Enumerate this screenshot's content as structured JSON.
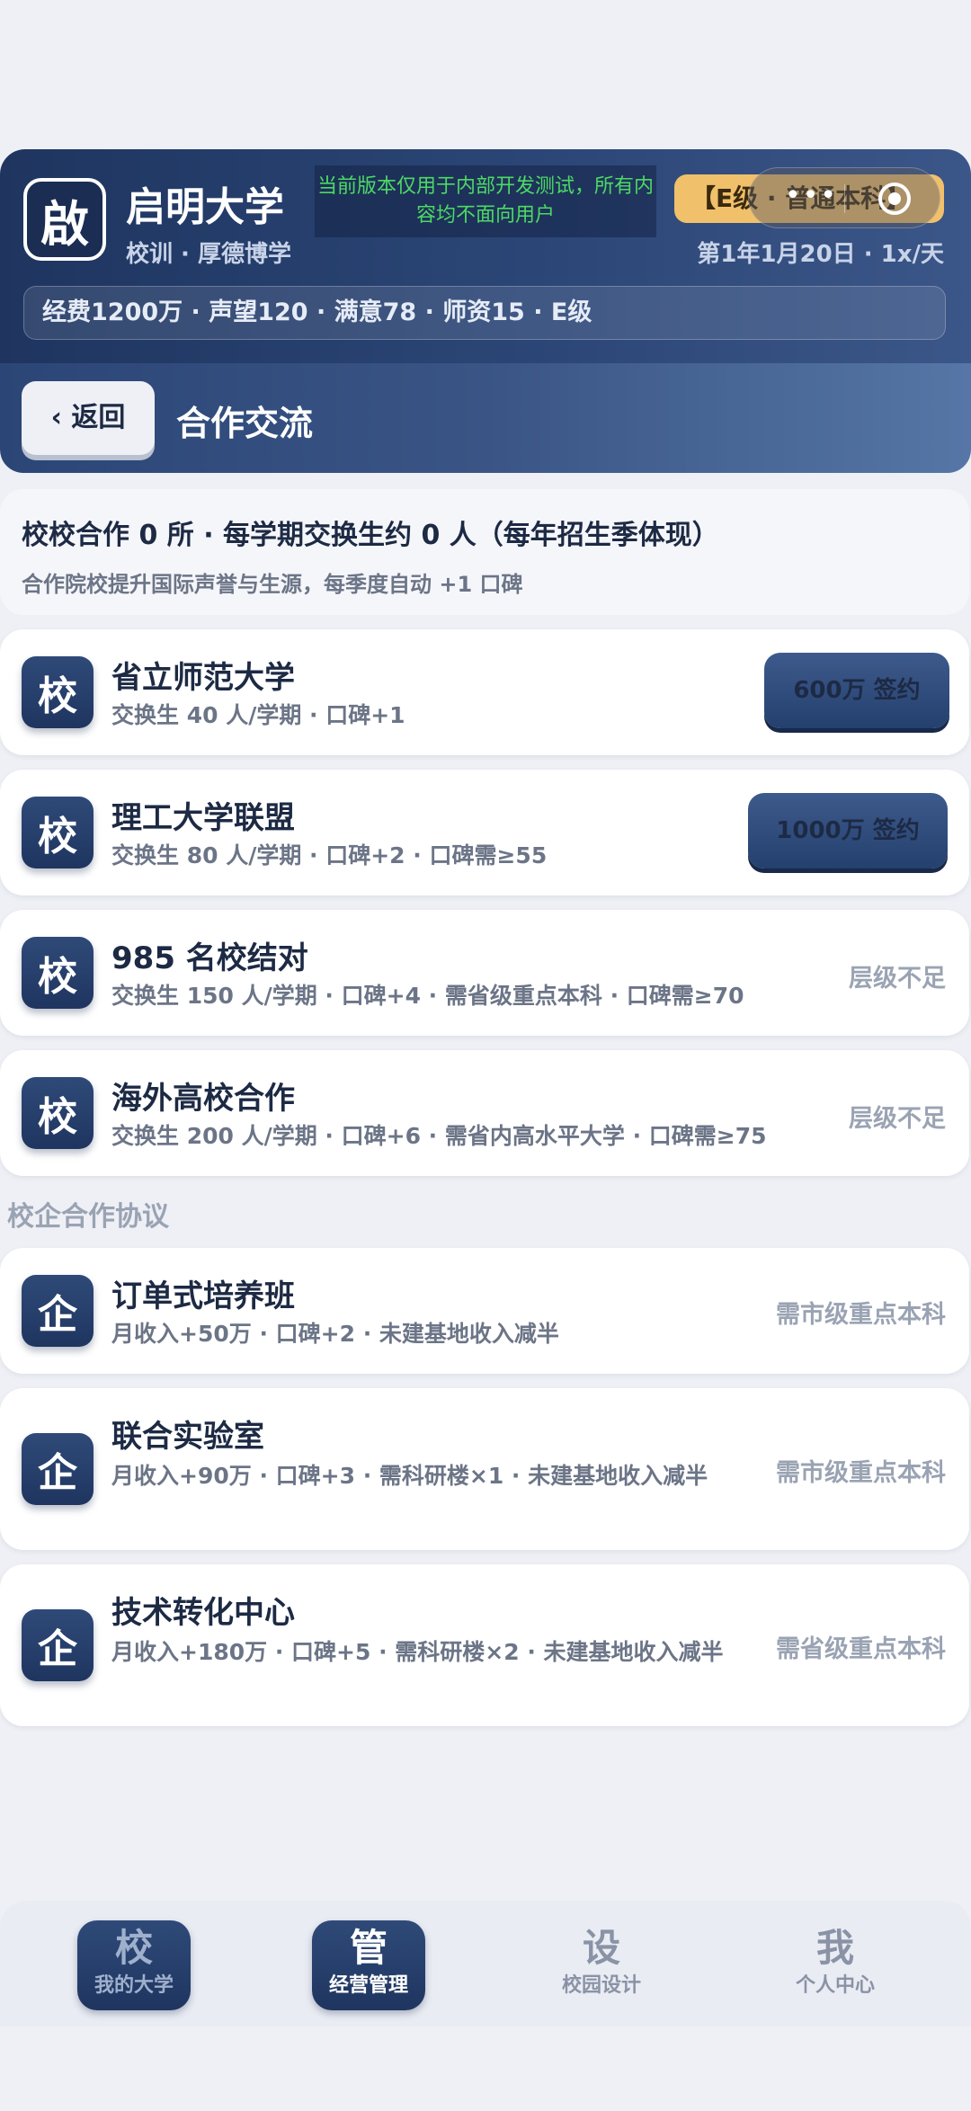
{
  "header": {
    "logo_char": "啟",
    "university_name": "启明大学",
    "motto": "校训 · 厚德博学",
    "notice": "当前版本仅用于内部开发测试，所有内容均不面向用户",
    "tier_badge": "【E级 · 普通本科】",
    "capsule_dots": "•••",
    "date_speed": "第1年1月20日 · 1x/天",
    "stats": "经费1200万 · 声望120 · 满意78 · 师资15 · E级"
  },
  "subheader": {
    "back_label": "‹ 返回",
    "title": "合作交流"
  },
  "summary": {
    "line1": "校校合作 0 所 · 每学期交换生约 0 人（每年招生季体现）",
    "line2": "合作院校提升国际声誉与生源，每季度自动 +1 口碑"
  },
  "school_partners": [
    {
      "icon": "校",
      "title": "省立师范大学",
      "sub": "交换生 40 人/学期 · 口碑+1",
      "action": "600万 签约"
    },
    {
      "icon": "校",
      "title": "理工大学联盟",
      "sub": "交换生 80 人/学期 · 口碑+2 · 口碑需≥55",
      "action": "1000万 签约"
    },
    {
      "icon": "校",
      "title": "985 名校结对",
      "sub": "交换生 150 人/学期 · 口碑+4 · 需省级重点本科 · 口碑需≥70",
      "status": "层级不足"
    },
    {
      "icon": "校",
      "title": "海外高校合作",
      "sub": "交换生 200 人/学期 · 口碑+6 · 需省内高水平大学 · 口碑需≥75",
      "status": "层级不足"
    }
  ],
  "enterprise_section_label": "校企合作协议",
  "enterprise_partners": [
    {
      "icon": "企",
      "title": "订单式培养班",
      "sub": "月收入+50万 · 口碑+2 · 未建基地收入减半",
      "status": "需市级重点本科"
    },
    {
      "icon": "企",
      "title": "联合实验室",
      "sub": "月收入+90万 · 口碑+3 · 需科研楼×1 · 未建基地收入减半",
      "status": "需市级重点本科"
    },
    {
      "icon": "企",
      "title": "技术转化中心",
      "sub": "月收入+180万 · 口碑+5 · 需科研楼×2 · 未建基地收入减半",
      "status": "需省级重点本科"
    }
  ],
  "tabbar": [
    {
      "icon": "校",
      "label": "我的大学"
    },
    {
      "icon": "管",
      "label": "经营管理"
    },
    {
      "icon": "设",
      "label": "校园设计"
    },
    {
      "icon": "我",
      "label": "个人中心"
    }
  ]
}
